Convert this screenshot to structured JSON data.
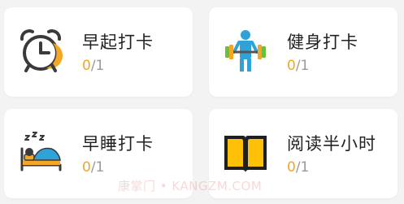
{
  "cards": [
    {
      "title": "早起打卡",
      "done": "0",
      "total": "/1",
      "icon": "alarm-clock-icon"
    },
    {
      "title": "健身打卡",
      "done": "0",
      "total": "/1",
      "icon": "weightlifter-icon"
    },
    {
      "title": "早睡打卡",
      "done": "0",
      "total": "/1",
      "icon": "sleeping-icon"
    },
    {
      "title": "阅读半小时",
      "done": "0",
      "total": "/1",
      "icon": "open-book-icon"
    }
  ],
  "watermark": "康掌门 • KANGZM.COM",
  "colors": {
    "accent": "#f5a623",
    "title_text": "#222222",
    "muted_text": "#9a9a9a",
    "card_bg": "#ffffff",
    "page_bg": "#f3f3f3",
    "fitness_blue": "#2fa3d8",
    "book_yellow": "#ffc107"
  }
}
